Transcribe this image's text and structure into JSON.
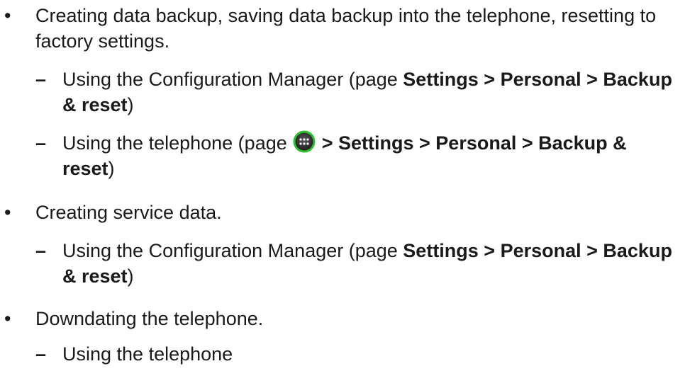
{
  "items": [
    {
      "bullet": "•",
      "text": "Creating data backup, saving data backup into the telephone, resetting to factory settings.",
      "subitems": [
        {
          "dash": "–",
          "pre": "Using the Configuration Manager (page ",
          "bold": "Settings > Personal > Backup & reset",
          "post": ")"
        },
        {
          "dash": "–",
          "pre": "Using the telephone (page ",
          "icon": "apps-grid-icon",
          "bold": " > Settings > Personal > Backup & reset",
          "post": ")"
        }
      ]
    },
    {
      "bullet": "•",
      "text": "Creating service data.",
      "subitems": [
        {
          "dash": "–",
          "pre": "Using the Configuration Manager (page ",
          "bold": "Settings > Personal > Backup & reset",
          "post": ")"
        }
      ]
    },
    {
      "bullet": "•",
      "text": "Downdating the telephone.",
      "subitems": [
        {
          "dash": "–",
          "text": "Using the telephone"
        }
      ]
    }
  ]
}
